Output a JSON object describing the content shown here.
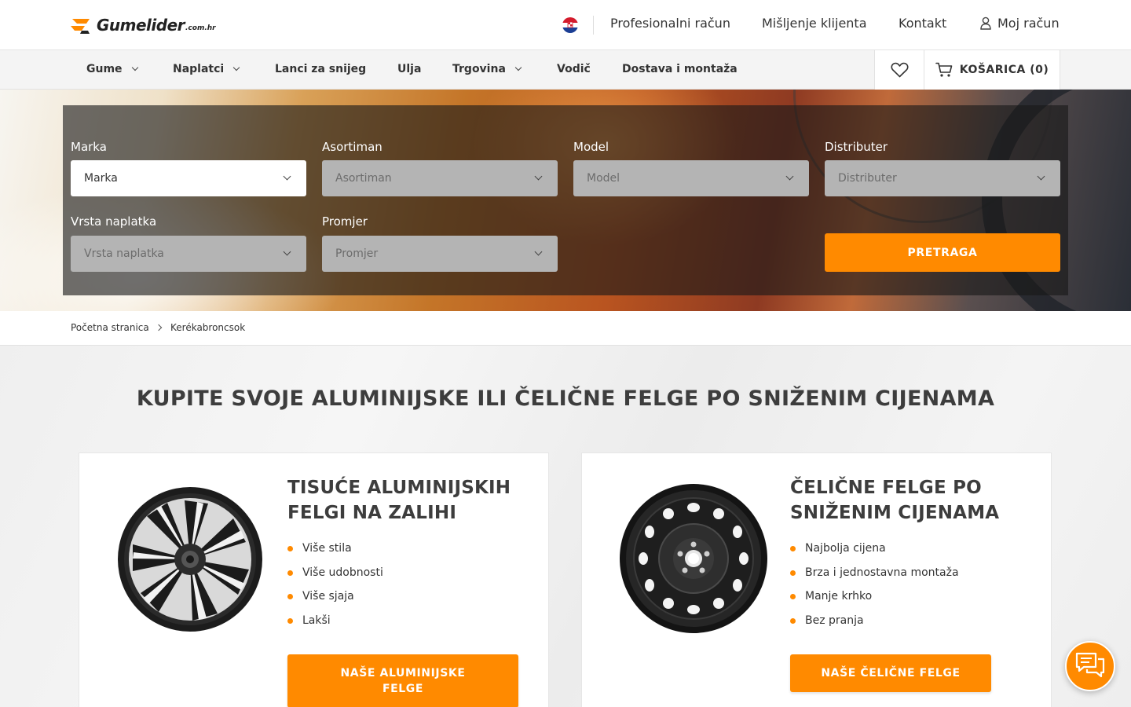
{
  "brand": {
    "name": "Gumelider",
    "suffix": ".com.hr"
  },
  "top_links": {
    "professional": "Profesionalni račun",
    "reviews": "Mišljenje klijenta",
    "contact": "Kontakt",
    "account": "Moj račun"
  },
  "nav": {
    "items": [
      {
        "label": "Gume",
        "has_dropdown": true
      },
      {
        "label": "Naplatci",
        "has_dropdown": true
      },
      {
        "label": "Lanci za snijeg",
        "has_dropdown": false
      },
      {
        "label": "Ulja",
        "has_dropdown": false
      },
      {
        "label": "Trgovina",
        "has_dropdown": true
      },
      {
        "label": "Vodič",
        "has_dropdown": false
      },
      {
        "label": "Dostava i montaža",
        "has_dropdown": false
      }
    ],
    "wishlist_icon": "heart-icon",
    "cart_label": "KOŠARICA (0)"
  },
  "search": {
    "brand": {
      "label": "Marka",
      "value": "Marka"
    },
    "range": {
      "label": "Asortiman",
      "value": "Asortiman"
    },
    "model": {
      "label": "Model",
      "value": "Model"
    },
    "distributor": {
      "label": "Distributer",
      "value": "Distributer"
    },
    "rim_type": {
      "label": "Vrsta naplatka",
      "value": "Vrsta naplatka"
    },
    "diameter": {
      "label": "Promjer",
      "value": "Promjer"
    },
    "submit": "PRETRAGA"
  },
  "breadcrumb": {
    "home": "Početna stranica",
    "current": "Kerékabroncsok"
  },
  "main": {
    "title": "KUPITE SVOJE ALUMINIJSKE ILI ČELIČNE FELGE PO SNIŽENIM CIJENAMA",
    "cards": [
      {
        "title_line1": "TISUĆE ALUMINIJSKIH",
        "title_line2": "FELGI NA ZALIHI",
        "bullets": [
          "Više stila",
          "Više udobnosti",
          "Više sjaja",
          "Lakši"
        ],
        "button_line1": "NAŠE ALUMINIJSKE",
        "button_line2": "FELGE"
      },
      {
        "title_line1": "ČELIČNE FELGE PO",
        "title_line2": "SNIŽENIM CIJENAMA",
        "bullets": [
          "Najbolja cijena",
          "Brza i jednostavna montaža",
          "Manje krhko",
          "Bez pranja"
        ],
        "button": "NAŠE ČELIČNE FELGE"
      }
    ]
  },
  "colors": {
    "accent": "#ff8a00",
    "text": "#333333",
    "title": "#3d3d3d"
  }
}
